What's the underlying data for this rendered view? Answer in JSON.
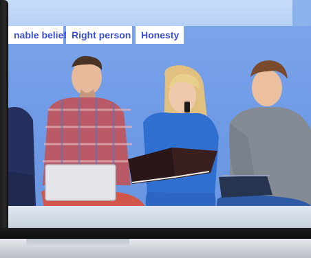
{
  "tags": [
    {
      "label": "nable belief"
    },
    {
      "label": "Right person"
    },
    {
      "label": "Honesty"
    }
  ],
  "colors": {
    "tag_text": "#3b4fd6",
    "screen_bg": "#7ea7ea",
    "top_band": "#c6dcf9"
  }
}
